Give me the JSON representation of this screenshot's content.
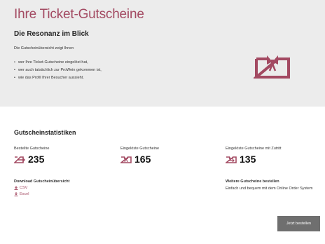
{
  "hero": {
    "title": "Ihre Ticket-Gutscheine",
    "subtitle": "Die Resonanz im Blick",
    "intro": "Die Gutscheinübersicht zeigt Ihnen",
    "bullets": [
      "wer Ihre Ticket-Gutscheine eingelöst hat,",
      "wer auch tatsächlich zur ProWein gekommen ist,",
      "wie das Profil Ihrer Besucher aussieht."
    ],
    "icon": "ticket-gift-icon"
  },
  "stats": {
    "section_title": "Gutscheinstatistiken",
    "items": [
      {
        "label": "Bestellte Gutscheine",
        "value": "235",
        "icon": "ticket-outgoing-icon"
      },
      {
        "label": "Eingelöste Gutscheine",
        "value": "165",
        "icon": "ticket-redeemed-icon"
      },
      {
        "label": "Eingelöste Gutscheine mit Zutritt",
        "value": "135",
        "icon": "ticket-entry-icon"
      }
    ]
  },
  "download": {
    "label": "Download Gutscheinübersicht",
    "links": [
      {
        "label": "CSV",
        "icon": "download-icon"
      },
      {
        "label": "Excel",
        "icon": "download-icon"
      }
    ]
  },
  "order": {
    "label": "Weitere Gutscheine bestellen",
    "text": "Einfach und bequem mit dem Online Order System",
    "button": "Jetzt bestellen"
  },
  "colors": {
    "accent": "#a34a62",
    "hero_background": "#ececec",
    "button_background": "#6f6f6f"
  }
}
